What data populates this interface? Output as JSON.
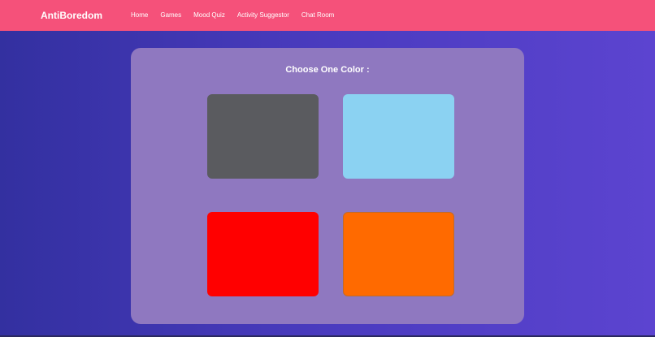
{
  "navbar": {
    "brand": "AntiBoredom",
    "background": "#f5517a",
    "links": [
      "Home",
      "Games",
      "Mood Quiz",
      "Activity Suggestor",
      "Chat Room"
    ]
  },
  "main": {
    "title": "Choose One Color :",
    "colors": [
      {
        "name": "dark-gray",
        "hex": "#5a5b5f"
      },
      {
        "name": "light-blue",
        "hex": "#8bd2f2"
      },
      {
        "name": "red",
        "hex": "#ff0000"
      },
      {
        "name": "orange",
        "hex": "#ff6a00"
      }
    ]
  }
}
